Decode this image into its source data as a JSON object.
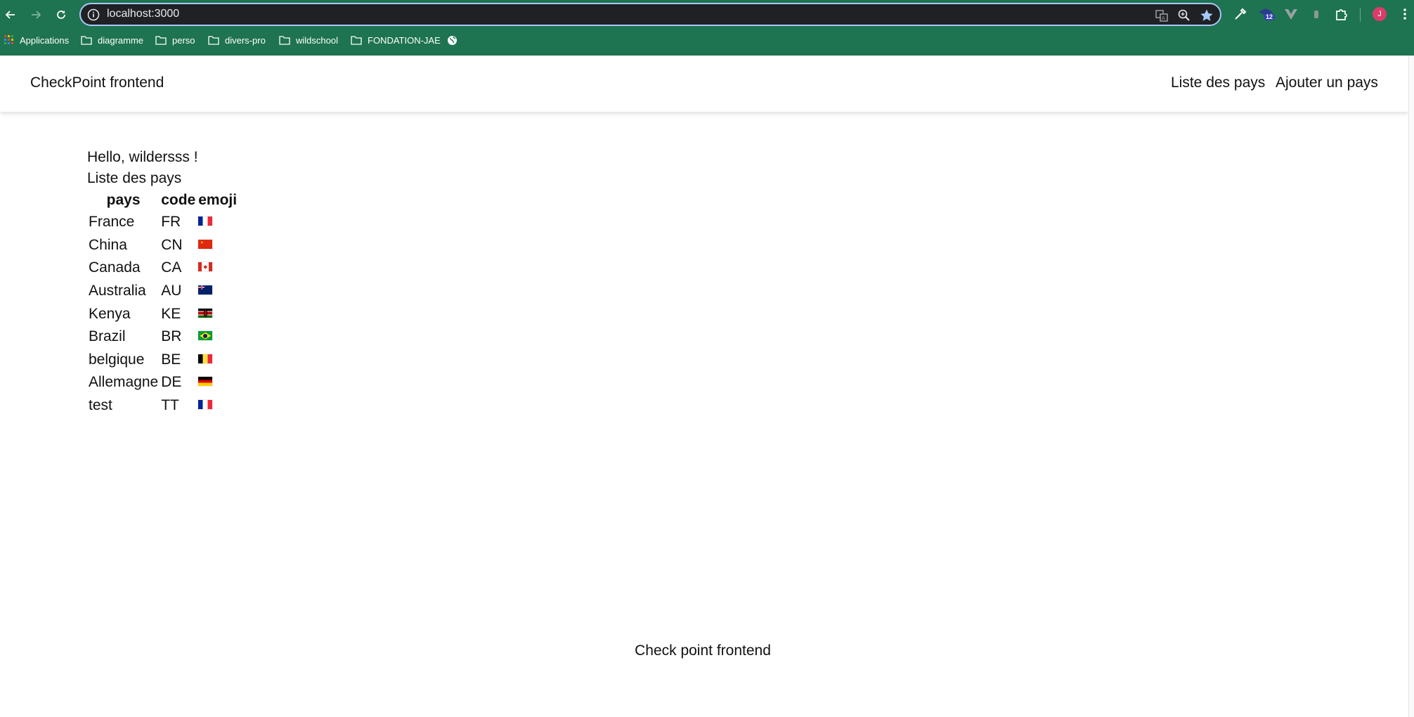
{
  "browser": {
    "url": "localhost:3000",
    "bookmarks": [
      {
        "label": "Applications",
        "icon": "apps-grid-icon"
      },
      {
        "label": "diagramme",
        "icon": "folder-icon"
      },
      {
        "label": "perso",
        "icon": "folder-icon"
      },
      {
        "label": "divers-pro",
        "icon": "folder-icon"
      },
      {
        "label": "wildschool",
        "icon": "folder-icon"
      },
      {
        "label": "FONDATION-JAE",
        "icon": "folder-icon"
      }
    ],
    "extension_badge": "12",
    "profile_initial": "J",
    "colors": {
      "chrome": "#1e7350",
      "omnibox": "#202124",
      "focus_ring": "#a8c7fa",
      "avatar": "#d93b6b"
    }
  },
  "header": {
    "brand": "CheckPoint frontend",
    "nav": [
      "Liste des pays",
      "Ajouter un pays"
    ]
  },
  "main": {
    "greeting": "Hello, wildersss !",
    "title": "Liste des pays",
    "table": {
      "columns": [
        "pays",
        "code",
        "emoji"
      ],
      "rows": [
        {
          "pays": "France",
          "code": "FR",
          "flag": "fr"
        },
        {
          "pays": "China",
          "code": "CN",
          "flag": "cn"
        },
        {
          "pays": "Canada",
          "code": "CA",
          "flag": "ca"
        },
        {
          "pays": "Australia",
          "code": "AU",
          "flag": "au"
        },
        {
          "pays": "Kenya",
          "code": "KE",
          "flag": "ke"
        },
        {
          "pays": "Brazil",
          "code": "BR",
          "flag": "br"
        },
        {
          "pays": "belgique",
          "code": "BE",
          "flag": "be"
        },
        {
          "pays": "Allemagne",
          "code": "DE",
          "flag": "de"
        },
        {
          "pays": "test",
          "code": "TT",
          "flag": "fr"
        }
      ]
    }
  },
  "footer": {
    "text": "Check point frontend"
  }
}
